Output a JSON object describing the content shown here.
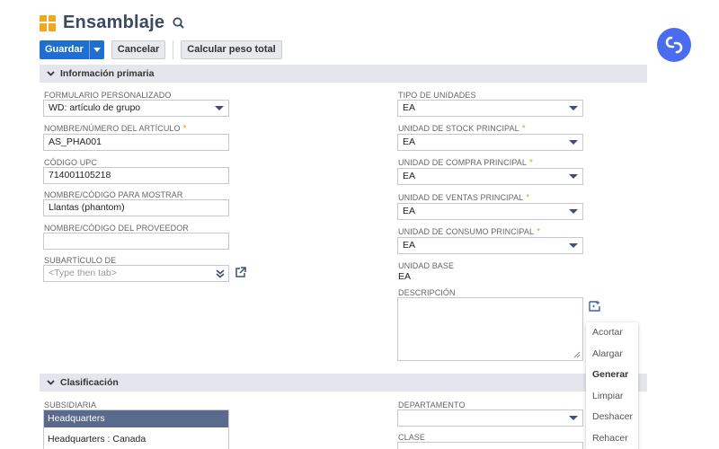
{
  "header": {
    "title": "Ensamblaje"
  },
  "toolbar": {
    "save_label": "Guardar",
    "cancel_label": "Cancelar",
    "calc_label": "Calcular peso total"
  },
  "sections": {
    "primary": "Información primaria",
    "classification": "Clasificación"
  },
  "left": {
    "form_label": "FORMULARIO PERSONALIZADO",
    "form_value": "WD: artículo de grupo",
    "name_label": "NOMBRE/NÚMERO DEL ARTÍCULO",
    "name_value": "AS_PHA001",
    "upc_label": "CÓDIGO UPC",
    "upc_value": "714001105218",
    "display_label": "NOMBRE/CÓDIGO PARA MOSTRAR",
    "display_value": "Llantas (phantom)",
    "vendor_label": "NOMBRE/CÓDIGO DEL PROVEEDOR",
    "vendor_value": "",
    "subitem_label": "SUBARTÍCULO DE",
    "subitem_placeholder": "<Type then tab>"
  },
  "right": {
    "units_type_label": "TIPO DE UNIDADES",
    "units_type_value": "EA",
    "stock_label": "UNIDAD DE STOCK PRINCIPAL",
    "stock_value": "EA",
    "purchase_label": "UNIDAD DE COMPRA PRINCIPAL",
    "purchase_value": "EA",
    "sales_label": "UNIDAD DE VENTAS PRINCIPAL",
    "sales_value": "EA",
    "consumption_label": "UNIDAD DE CONSUMO PRINCIPAL",
    "consumption_value": "EA",
    "base_label": "UNIDAD BASE",
    "base_value": "EA",
    "description_label": "DESCRIPCIÓN"
  },
  "ai_menu": {
    "items": [
      "Acortar",
      "Alargar",
      "Generar",
      "Limpiar",
      "Deshacer",
      "Rehacer"
    ]
  },
  "classification": {
    "subsidiary_label": "SUBSIDIARIA",
    "subsidiaries": [
      "Headquarters",
      "Headquarters : Canada"
    ],
    "department_label": "DEPARTAMENTO",
    "department_value": "",
    "class_label": "CLASE"
  },
  "colors": {
    "accent": "#1f6fd1",
    "required": "#e6a015",
    "logo": "#4a6cf0",
    "selected_row": "#5a6a8c"
  }
}
